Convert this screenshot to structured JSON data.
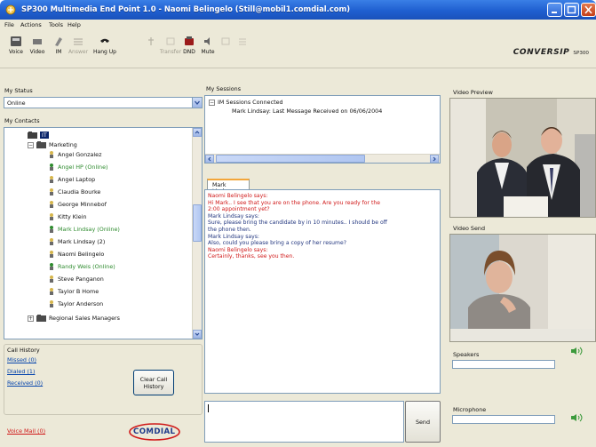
{
  "window": {
    "title": "SP300 Multimedia End Point 1.0 - Naomi Belingelo (Still@mobil1.comdial.com)"
  },
  "menu": [
    "File",
    "Actions",
    "Tools",
    "Help"
  ],
  "toolbar": {
    "buttons": [
      {
        "label": "Voice",
        "icon": "voice-icon"
      },
      {
        "label": "Video",
        "icon": "video-icon"
      },
      {
        "label": "IM",
        "icon": "im-icon"
      },
      {
        "label": "Answer",
        "icon": "answer-icon"
      },
      {
        "label": "Hang Up",
        "icon": "hang-up-icon"
      },
      {
        "label": "Hold",
        "icon": "hold-icon"
      },
      {
        "label": "DND",
        "icon": "dnd-icon"
      },
      {
        "label": "Mute",
        "icon": "mute-icon"
      },
      {
        "label": "Transfer",
        "icon": "transfer-icon"
      },
      {
        "label": "Conf",
        "icon": "conference-icon"
      }
    ]
  },
  "brand": {
    "name": "CONVERSIP",
    "model": "SP300"
  },
  "status": {
    "label": "My Status",
    "value": "Online"
  },
  "contacts": {
    "label": "My Contacts",
    "root": "IT",
    "group": "Marketing",
    "members": [
      {
        "name": "Angel Gonzalez",
        "online": false
      },
      {
        "name": "Angel HP (Online)",
        "online": true
      },
      {
        "name": "Angel Laptop",
        "online": false
      },
      {
        "name": "Claudia Bourke",
        "online": false
      },
      {
        "name": "George Minnebof",
        "online": false
      },
      {
        "name": "Kitty Klein",
        "online": false
      },
      {
        "name": "Mark Lindsay (Online)",
        "online": true
      },
      {
        "name": "Mark Lindsay (2)",
        "online": false
      },
      {
        "name": "Naomi Belingelo",
        "online": false
      },
      {
        "name": "Randy Weis (Online)",
        "online": true
      },
      {
        "name": "Steve Panganon",
        "online": false
      },
      {
        "name": "Taylor B Home",
        "online": false
      },
      {
        "name": "Taylor Anderson",
        "online": false
      }
    ],
    "other_group": "Regional Sales Managers"
  },
  "call_history": {
    "label": "Call History",
    "missed": "Missed (0)",
    "dialed": "Dialed (1)",
    "received": "Received (0)",
    "clear_button": "Clear Call History"
  },
  "voicemail": {
    "label": "Voice Mail (0)"
  },
  "logo": {
    "text": "COMDIAL"
  },
  "sessions": {
    "label": "My Sessions",
    "items": [
      {
        "text": "IM Sessions Connected"
      },
      {
        "text": "Mark Lindsay: Last Message Received on 06/06/2004"
      }
    ]
  },
  "chat": {
    "tab": "Mark Lindsay",
    "lines": [
      {
        "text": "Naomi Belingelo says:",
        "color": "#d01818"
      },
      {
        "text": "Hi Mark.. I see that you are on the phone. Are you ready for the",
        "color": "#d01818"
      },
      {
        "text": "2:00 appointment yet?",
        "color": "#d01818"
      },
      {
        "text": "Mark Lindsay says:",
        "color": "#22367f"
      },
      {
        "text": "Sure, please bring the candidate by in 10 minutes.. I should be off",
        "color": "#22367f"
      },
      {
        "text": "the phone then.",
        "color": "#22367f"
      },
      {
        "text": "Mark Lindsay says:",
        "color": "#22367f"
      },
      {
        "text": "Also, could you please bring a copy of her resume?",
        "color": "#22367f"
      },
      {
        "text": "Naomi Belingelo says:",
        "color": "#d01818"
      },
      {
        "text": "Certainly, thanks, see you then.",
        "color": "#d01818"
      }
    ],
    "send_button": "Send"
  },
  "video": {
    "preview_label": "Video Preview",
    "send_label": "Video Send"
  },
  "audio": {
    "speakers_label": "Speakers",
    "microphone_label": "Microphone"
  }
}
